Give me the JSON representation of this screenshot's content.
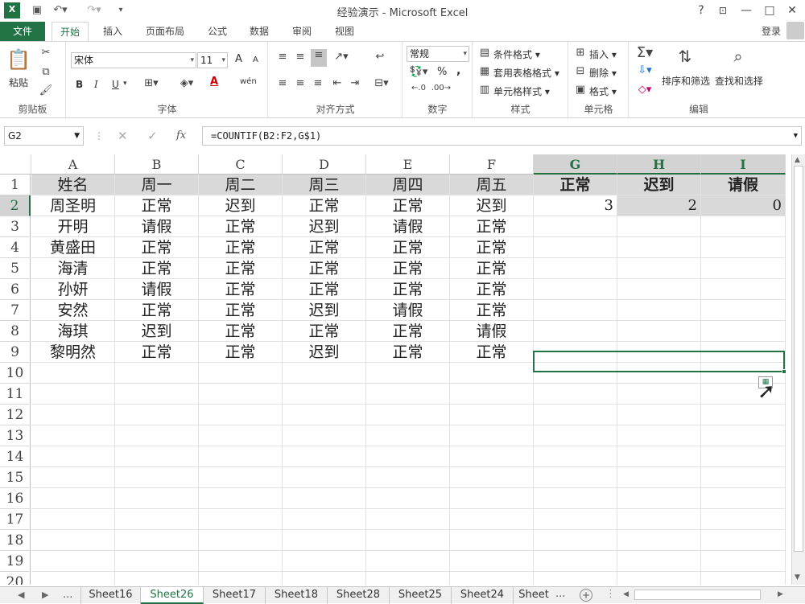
{
  "window": {
    "title": "经验演示 - Microsoft Excel",
    "help": "?",
    "signin": "登录"
  },
  "menu": {
    "file": "文件",
    "tabs": [
      "开始",
      "插入",
      "页面布局",
      "公式",
      "数据",
      "审阅",
      "视图"
    ]
  },
  "ribbon": {
    "clipboard": {
      "paste": "粘贴",
      "label": "剪贴板"
    },
    "font": {
      "name": "宋体",
      "size": "11",
      "bold": "B",
      "italic": "I",
      "underline": "U",
      "grow": "A",
      "shrink": "A",
      "wen": "wén",
      "label": "字体"
    },
    "alignment": {
      "label": "对齐方式"
    },
    "number": {
      "format": "常规",
      "percent": "%",
      "comma": ",",
      "label": "数字"
    },
    "styles": {
      "conditional": "条件格式",
      "table": "套用表格格式",
      "cell": "单元格样式",
      "label": "样式"
    },
    "cells": {
      "insert": "插入",
      "delete": "删除",
      "format": "格式",
      "label": "单元格"
    },
    "editing": {
      "sort": "排序和筛选",
      "find": "查找和选择",
      "label": "编辑"
    }
  },
  "formula_bar": {
    "name_box": "G2",
    "fx": "fx",
    "formula": "=COUNTIF(B2:F2,G$1)"
  },
  "columns": [
    "A",
    "B",
    "C",
    "D",
    "E",
    "F",
    "G",
    "H",
    "I"
  ],
  "rows": [
    "1",
    "2",
    "3",
    "4",
    "5",
    "6",
    "7",
    "8",
    "9",
    "10",
    "11",
    "12",
    "13",
    "14",
    "15",
    "16",
    "17",
    "18",
    "19",
    "20"
  ],
  "sheet": {
    "header": [
      "姓名",
      "周一",
      "周二",
      "周三",
      "周四",
      "周五",
      "正常",
      "迟到",
      "请假"
    ],
    "data": [
      [
        "周圣明",
        "正常",
        "迟到",
        "正常",
        "正常",
        "迟到"
      ],
      [
        "开明",
        "请假",
        "正常",
        "迟到",
        "请假",
        "正常"
      ],
      [
        "黄盛田",
        "正常",
        "正常",
        "正常",
        "正常",
        "正常"
      ],
      [
        "海清",
        "正常",
        "正常",
        "正常",
        "正常",
        "正常"
      ],
      [
        "孙妍",
        "请假",
        "正常",
        "正常",
        "正常",
        "正常"
      ],
      [
        "安然",
        "正常",
        "正常",
        "迟到",
        "请假",
        "正常"
      ],
      [
        "海琪",
        "迟到",
        "正常",
        "正常",
        "正常",
        "请假"
      ],
      [
        "黎明然",
        "正常",
        "正常",
        "迟到",
        "正常",
        "正常"
      ]
    ],
    "results": [
      "3",
      "2",
      "0"
    ]
  },
  "sheet_tabs": {
    "ellipsis": "...",
    "tabs": [
      "Sheet16",
      "Sheet26",
      "Sheet17",
      "Sheet18",
      "Sheet28",
      "Sheet25",
      "Sheet24",
      "Sheet"
    ],
    "more": "...",
    "active": "Sheet26"
  },
  "colors": {
    "accent": "#217346",
    "header_fill": "#d9d9d9"
  }
}
